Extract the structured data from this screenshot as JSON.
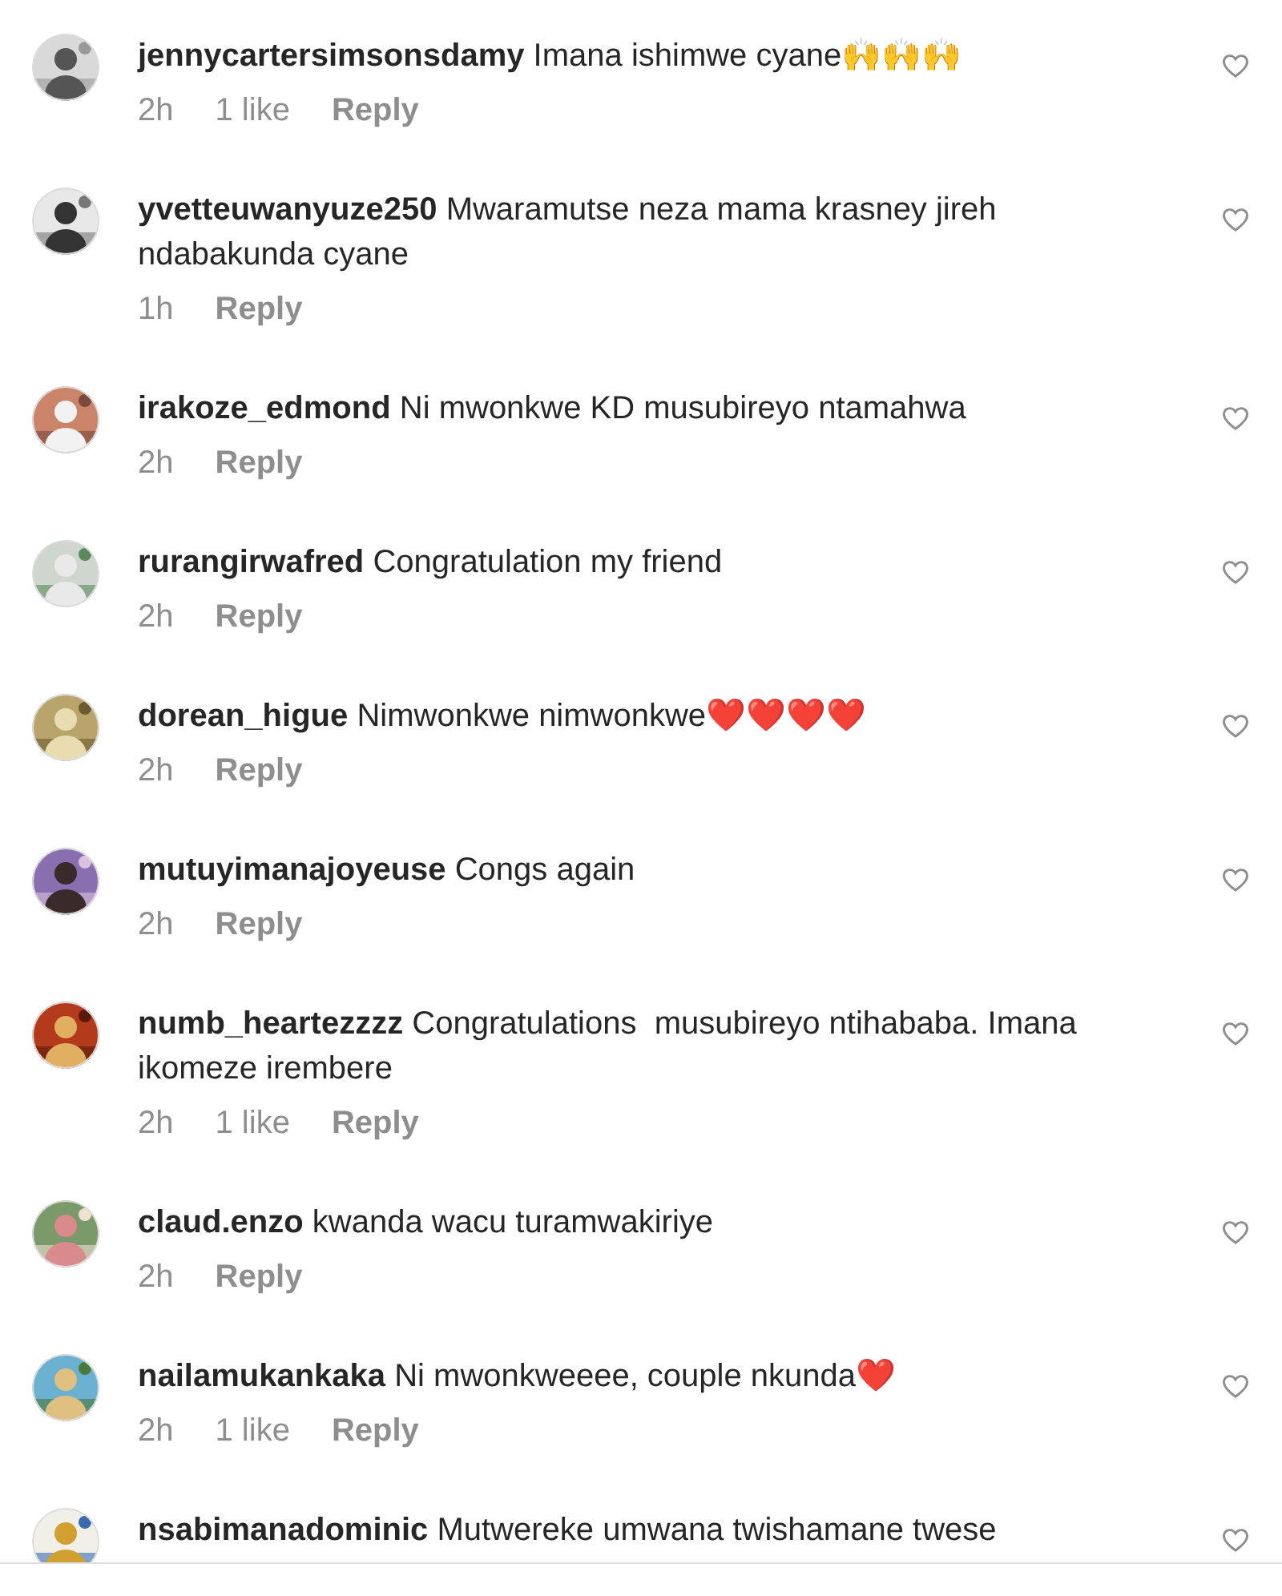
{
  "comments": [
    {
      "username": "jennycartersimsonsdamy",
      "text": "Imana ishimwe cyane🙌🙌🙌",
      "time": "2h",
      "likes": "1 like",
      "reply": "Reply",
      "liked": false
    },
    {
      "username": "yvetteuwanyuze250",
      "text": "Mwaramutse neza mama krasney jireh ndabakunda cyane",
      "time": "1h",
      "reply": "Reply",
      "liked": false
    },
    {
      "username": "irakoze_edmond",
      "text": "Ni mwonkwe KD musubireyo ntamahwa",
      "time": "2h",
      "reply": "Reply",
      "liked": false
    },
    {
      "username": "rurangirwafred",
      "text": "Congratulation my friend",
      "time": "2h",
      "reply": "Reply",
      "liked": false
    },
    {
      "username": "dorean_higue",
      "text": "Nimwonkwe nimwonkwe❤️❤️❤️❤️",
      "time": "2h",
      "reply": "Reply",
      "liked": false
    },
    {
      "username": "mutuyimanajoyeuse",
      "text": "Congs again",
      "time": "2h",
      "reply": "Reply",
      "liked": false
    },
    {
      "username": "numb_heartezzzz",
      "text": "Congratulations  musubireyo ntihababa. Imana ikomeze irembere",
      "time": "2h",
      "likes": "1 like",
      "reply": "Reply",
      "liked": false
    },
    {
      "username": "claud.enzo",
      "text": "kwanda wacu turamwakiriye",
      "time": "2h",
      "reply": "Reply",
      "liked": false
    },
    {
      "username": "nailamukankaka",
      "text": "Ni mwonkweeee, couple nkunda❤️",
      "time": "2h",
      "likes": "1 like",
      "reply": "Reply",
      "liked": false
    },
    {
      "username": "nsabimanadominic",
      "text": "Mutwereke umwana twishamane twese",
      "liked": false
    }
  ]
}
